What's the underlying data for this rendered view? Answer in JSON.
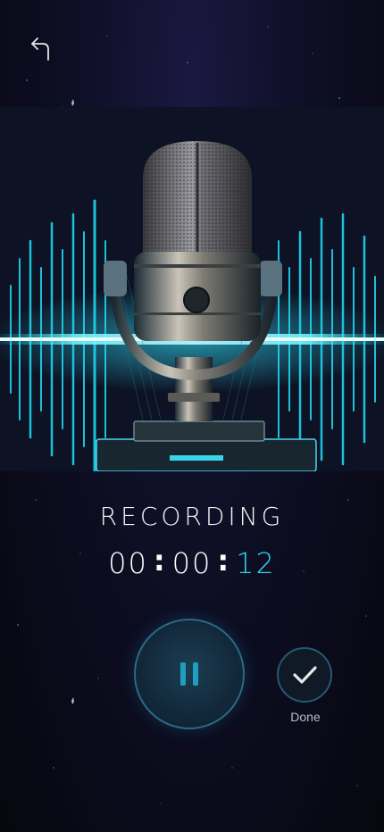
{
  "header": {
    "back_icon": "back-arrow-icon"
  },
  "hero": {
    "image": "microphone-soundwave-illustration",
    "accent_color": "#19d6ef"
  },
  "recording": {
    "status_label": "RECORDING",
    "timer": {
      "hours": "00",
      "minutes": "00",
      "seconds": "12",
      "separator": ":"
    }
  },
  "controls": {
    "pause_icon": "pause-icon",
    "done_icon": "checkmark-icon",
    "done_label": "Done"
  },
  "colors": {
    "background": "#0b0c1c",
    "accent": "#2fd4e6",
    "button_ring": "#2a6a86"
  }
}
